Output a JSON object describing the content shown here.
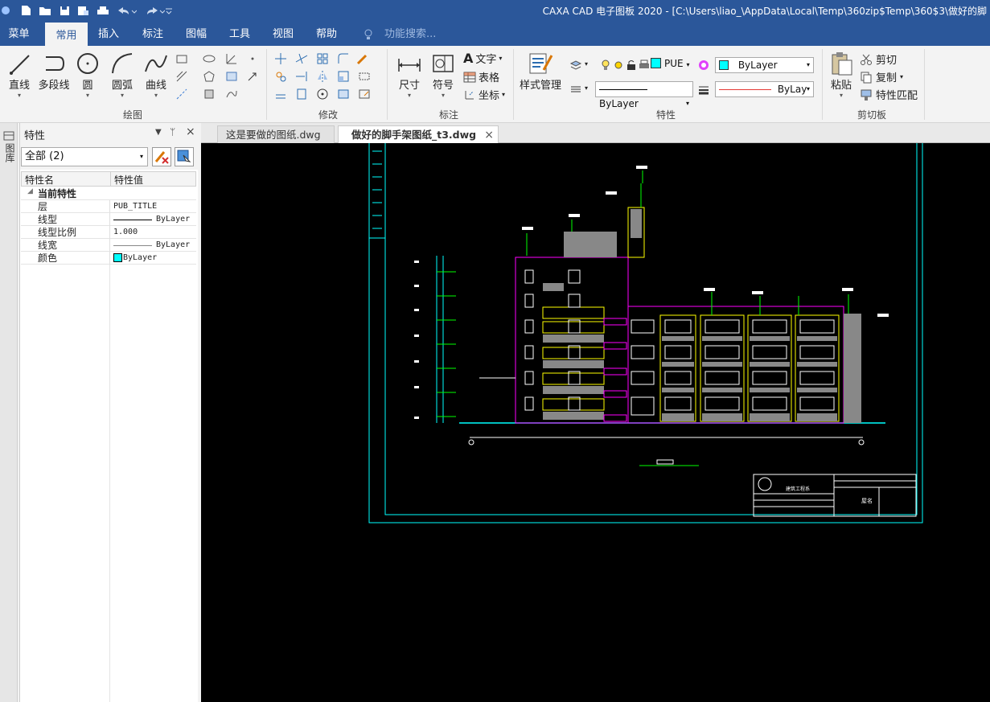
{
  "app": {
    "title": "CAXA CAD 电子图板 2020 - [C:\\Users\\liao_\\AppData\\Local\\Temp\\360zip$Temp\\360$3\\做好的脚"
  },
  "menu": {
    "items": [
      "菜单",
      "常用",
      "插入",
      "标注",
      "图幅",
      "工具",
      "视图",
      "帮助"
    ],
    "active": "常用",
    "search_placeholder": "功能搜索..."
  },
  "ribbon": {
    "draw": {
      "label": "绘图",
      "buttons": [
        "直线",
        "多段线",
        "圆",
        "圆弧",
        "曲线"
      ]
    },
    "modify": {
      "label": "修改"
    },
    "annotate": {
      "label": "标注",
      "buttons": [
        "尺寸",
        "符号"
      ],
      "small": [
        "文字",
        "表格",
        "坐标"
      ]
    },
    "properties": {
      "label": "特性",
      "style_button": "样式管理",
      "layer_value": "PUE",
      "color_value": "ByLayer",
      "linetype_value": "ByLayer",
      "linewidth_value": "ByLay",
      "accent_color": "#00ffff"
    },
    "clipboard": {
      "label": "剪切板",
      "paste": "粘贴",
      "cut": "剪切",
      "copy": "复制",
      "match": "特性匹配"
    }
  },
  "side_tab": {
    "label": "图库"
  },
  "panel": {
    "title": "特性",
    "filter_value": "全部 (2)",
    "columns": [
      "特性名",
      "特性值"
    ],
    "section": "当前特性",
    "rows": [
      {
        "name": "层",
        "value": "PUB_TITLE"
      },
      {
        "name": "线型",
        "value": "ByLayer"
      },
      {
        "name": "线型比例",
        "value": "1.000"
      },
      {
        "name": "线宽",
        "value": "ByLayer"
      },
      {
        "name": "颜色",
        "value": "ByLayer"
      }
    ]
  },
  "tabs": [
    {
      "label": "这是要做的图纸.dwg",
      "active": false
    },
    {
      "label": "做好的脚手架图纸_t3.dwg",
      "active": true
    }
  ],
  "drawing": {
    "title_block": {
      "company": "建筑工程系",
      "sheet": "屋名"
    }
  },
  "colors": {
    "titlebar": "#2b579a",
    "ribbon": "#f3f3f3",
    "canvas": "#000000",
    "cyan": "#00ffff",
    "magenta": "#ff00ff",
    "yellow": "#ffff00",
    "green": "#00ff00"
  }
}
